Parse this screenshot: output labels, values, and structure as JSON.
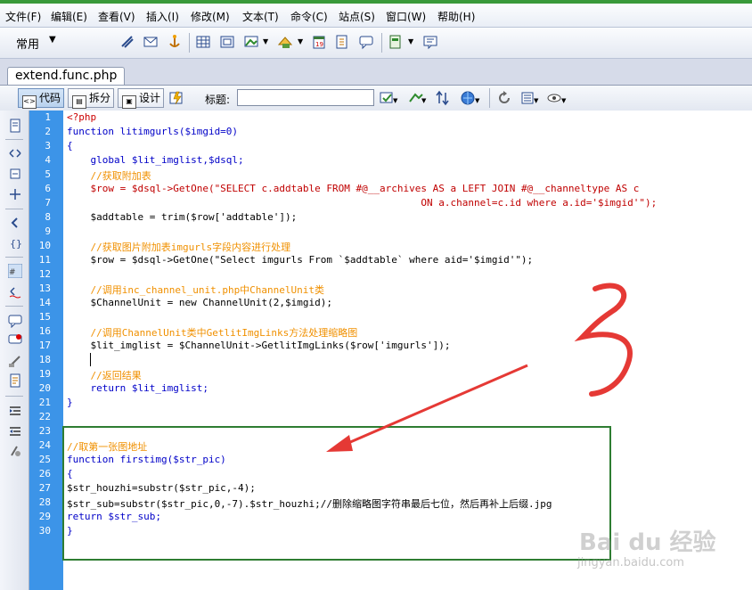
{
  "menu": [
    "文件(F)",
    "编辑(E)",
    "查看(V)",
    "插入(I)",
    "修改(M)",
    "文本(T)",
    "命令(C)",
    "站点(S)",
    "窗口(W)",
    "帮助(H)"
  ],
  "toolbar": {
    "category": "常用"
  },
  "tab": {
    "filename": "extend.func.php"
  },
  "viewbar": {
    "code_label": "代码",
    "split_label": "拆分",
    "design_label": "设计",
    "title_label": "标题:",
    "title_value": ""
  },
  "editor": {
    "line_numbers": [
      "1",
      "2",
      "3",
      "4",
      "5",
      "6",
      "7",
      "8",
      "9",
      "10",
      "11",
      "12",
      "13",
      "14",
      "15",
      "16",
      "17",
      "18",
      "19",
      "20",
      "21",
      "22",
      "23",
      "24",
      "25",
      "26",
      "27",
      "28",
      "29",
      "30"
    ],
    "lines": [
      "<?php",
      "function litimgurls($imgid=0)",
      "{",
      "    global $lit_imglist,$dsql;",
      "    //获取附加表",
      "    $row = $dsql->GetOne(\"SELECT c.addtable FROM #@__archives AS a LEFT JOIN #@__channeltype AS c",
      "                                                            ON a.channel=c.id where a.id='$imgid'\");",
      "    $addtable = trim($row['addtable']);",
      "",
      "    //获取图片附加表imgurls字段内容进行处理",
      "    $row = $dsql->GetOne(\"Select imgurls From `$addtable` where aid='$imgid'\");",
      "",
      "    //调用inc_channel_unit.php中ChannelUnit类",
      "    $ChannelUnit = new ChannelUnit(2,$imgid);",
      "",
      "    //调用ChannelUnit类中GetlitImgLinks方法处理缩略图",
      "    $lit_imglist = $ChannelUnit->GetlitImgLinks($row['imgurls']);",
      "",
      "    //返回结果",
      "    return $lit_imglist;",
      "}",
      "",
      "",
      "//取第一张图地址",
      "function firstimg($str_pic)",
      "{",
      "$str_houzhi=substr($str_pic,-4);",
      "$str_sub=substr($str_pic,0,-7).$str_houzhi;//删除缩略图字符串最后七位，然后再补上后缀.jpg",
      "return $str_sub;",
      "}"
    ]
  },
  "watermark": {
    "brand": "Bai du 经验",
    "url": "jingyan.baidu.com"
  },
  "colors": {
    "gutter": "#3c94e8",
    "keyword": "#0000c8",
    "comment": "#f09000",
    "string": "#c00000",
    "annotation": "#e53935",
    "highlight_box": "#2e7d32"
  }
}
